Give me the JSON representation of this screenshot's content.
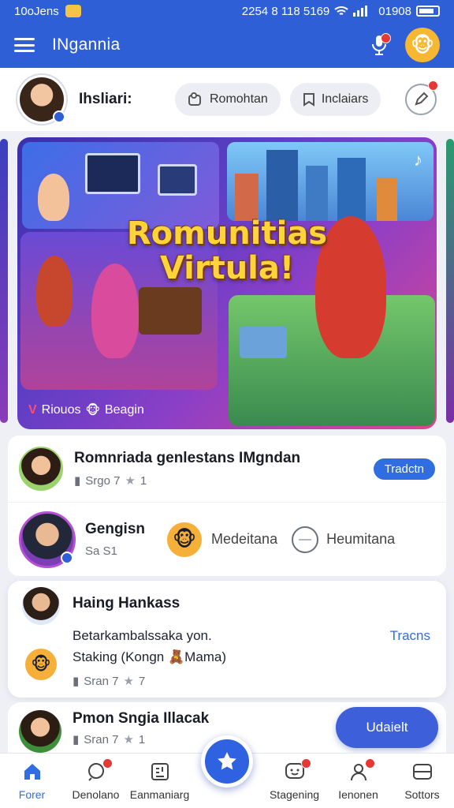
{
  "status_bar": {
    "left_text": "10oJens",
    "right_text": "2254 8 118 5169",
    "battery_text": "01908"
  },
  "app_bar": {
    "title": "INgannia"
  },
  "profile": {
    "name": "Ihsliari:",
    "pills": [
      {
        "label": "Romohtan",
        "icon": "group-icon"
      },
      {
        "label": "Inclaiars",
        "icon": "bookmark-icon"
      }
    ]
  },
  "banner": {
    "title_line1": "Romunitias",
    "title_line2": "Virtula!",
    "footer_label": "Riouos",
    "footer_label2": "Beagin"
  },
  "feed": {
    "row1": {
      "title": "Romnriada genlestans IMgndan",
      "meta_a": "Srgo 7",
      "meta_b": "1",
      "tag": "Tradctn"
    },
    "row2": {
      "title": "Gengisn",
      "meta": "Sa S1",
      "chip1": "Medeitana",
      "chip2": "Heumitana"
    },
    "row3": {
      "title": "Haing Hankass",
      "line1": "Betarkambalssaka yon.",
      "line2": "Staking (Kongn",
      "line2b": "Mama)",
      "meta_a": "Sran 7",
      "meta_b": "7",
      "link": "Tracns"
    },
    "row4": {
      "title": "Pmon Sngia Illacak",
      "meta_a": "Sran 7",
      "meta_b": "1",
      "button": "Udaielt"
    }
  },
  "bottom_nav": [
    {
      "label": "Forer",
      "icon": "home-icon",
      "active": true
    },
    {
      "label": "Denolano",
      "icon": "chat-icon",
      "badge": true
    },
    {
      "label": "Eanmaniarg",
      "icon": "grid-icon"
    },
    {
      "label": "Stagening",
      "icon": "smiley-chat-icon",
      "badge": true
    },
    {
      "label": "Ienonen",
      "icon": "person-icon",
      "badge": true
    },
    {
      "label": "Sottors",
      "icon": "settings-icon"
    }
  ],
  "colors": {
    "primary": "#2f5fd6",
    "accent": "#2f6de0",
    "badge": "#e53935",
    "title_yellow": "#ffd43b"
  }
}
